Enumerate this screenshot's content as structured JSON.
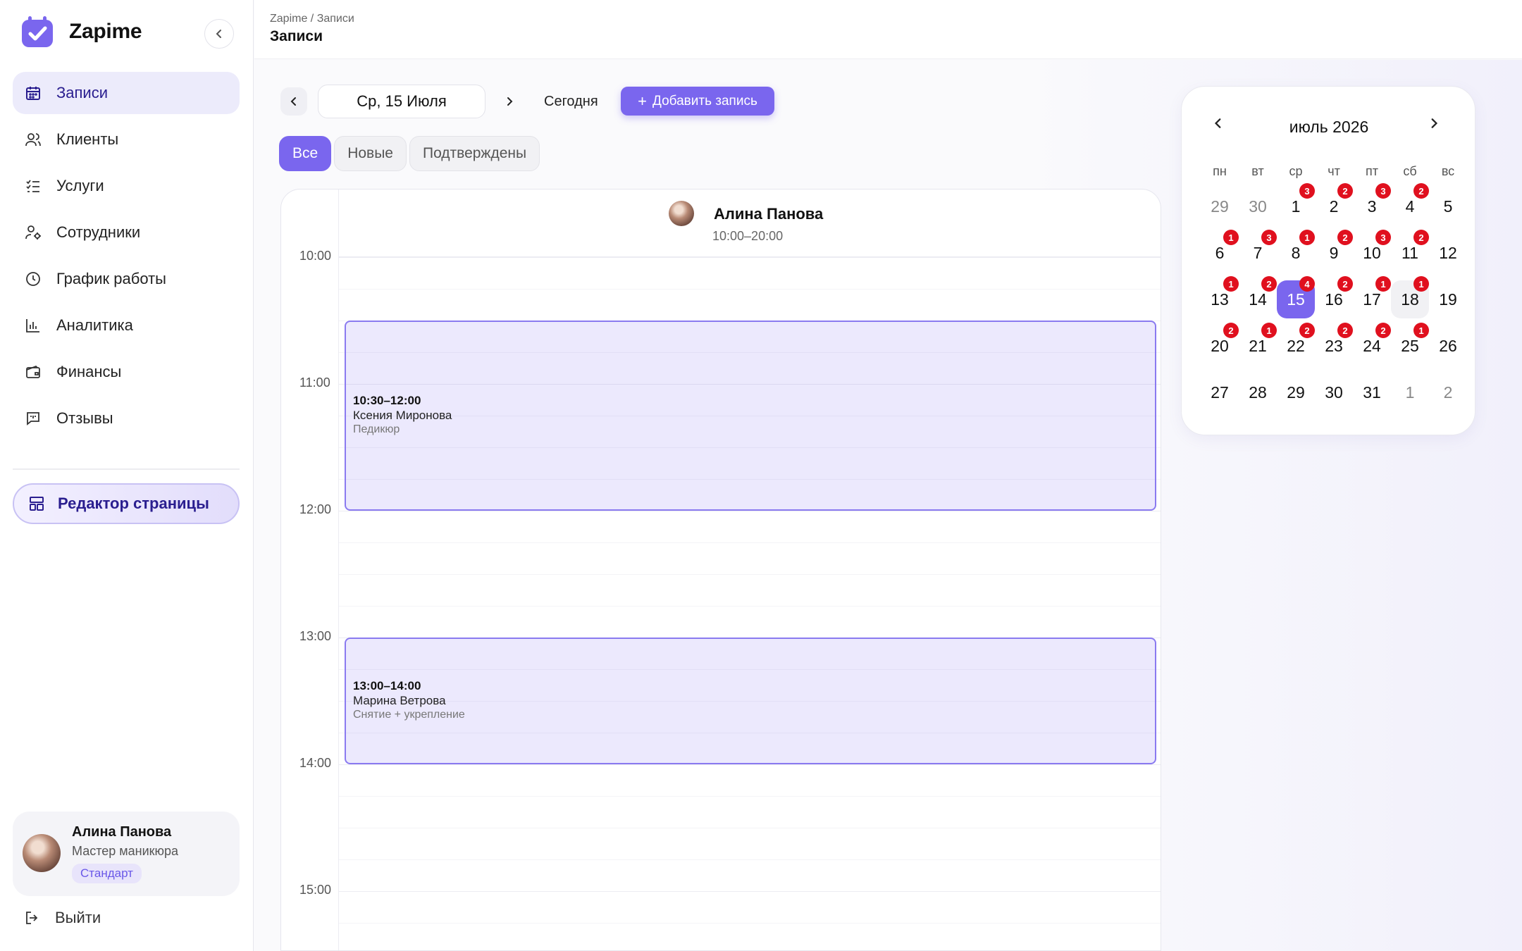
{
  "app": {
    "name": "Zapime",
    "accent": "#7a66ee",
    "badge_color": "#e0101e"
  },
  "sidebar": {
    "items": [
      {
        "label": "Записи",
        "icon": "calendar-icon",
        "active": true
      },
      {
        "label": "Клиенты",
        "icon": "users-icon"
      },
      {
        "label": "Услуги",
        "icon": "checklist-icon"
      },
      {
        "label": "Сотрудники",
        "icon": "staff-icon"
      },
      {
        "label": "График работы",
        "icon": "clock-icon"
      },
      {
        "label": "Аналитика",
        "icon": "bar-chart-icon"
      },
      {
        "label": "Финансы",
        "icon": "wallet-icon"
      },
      {
        "label": "Отзывы",
        "icon": "message-icon"
      }
    ],
    "editor_label": "Редактор страницы",
    "profile": {
      "name": "Алина Панова",
      "role": "Мастер маникюра",
      "plan": "Стандарт"
    },
    "logout_label": "Выйти"
  },
  "header": {
    "breadcrumb": "Zapime / Записи",
    "title": "Записи"
  },
  "toolbar": {
    "date": "Ср, 15 Июля",
    "today_label": "Сегодня",
    "add_label": "Добавить запись"
  },
  "filters": [
    {
      "label": "Все",
      "active": true
    },
    {
      "label": "Новые"
    },
    {
      "label": "Подтверждены"
    }
  ],
  "schedule": {
    "employee": {
      "name": "Алина Панова",
      "hours": "10:00–20:00"
    },
    "time_labels": [
      "10:00",
      "11:00",
      "12:00",
      "13:00",
      "14:00",
      "15:00"
    ],
    "appointments": [
      {
        "time": "10:30–12:00",
        "client": "Ксения Миронова",
        "service": "Педикюр"
      },
      {
        "time": "13:00–14:00",
        "client": "Марина Ветрова",
        "service": "Снятие + укрепление"
      }
    ]
  },
  "mini_calendar": {
    "title": "июль 2026",
    "weekdays": [
      "пн",
      "вт",
      "ср",
      "чт",
      "пт",
      "сб",
      "вс"
    ],
    "days": [
      {
        "d": "29",
        "out": true
      },
      {
        "d": "30",
        "out": true
      },
      {
        "d": "1",
        "b": "3"
      },
      {
        "d": "2",
        "b": "2"
      },
      {
        "d": "3",
        "b": "3"
      },
      {
        "d": "4",
        "b": "2"
      },
      {
        "d": "5"
      },
      {
        "d": "6",
        "b": "1"
      },
      {
        "d": "7",
        "b": "3"
      },
      {
        "d": "8",
        "b": "1"
      },
      {
        "d": "9",
        "b": "2"
      },
      {
        "d": "10",
        "b": "3"
      },
      {
        "d": "11",
        "b": "2"
      },
      {
        "d": "12"
      },
      {
        "d": "13",
        "b": "1"
      },
      {
        "d": "14",
        "b": "2"
      },
      {
        "d": "15",
        "b": "4",
        "sel": true
      },
      {
        "d": "16",
        "b": "2"
      },
      {
        "d": "17",
        "b": "1"
      },
      {
        "d": "18",
        "b": "1",
        "hov": true
      },
      {
        "d": "19"
      },
      {
        "d": "20",
        "b": "2"
      },
      {
        "d": "21",
        "b": "1"
      },
      {
        "d": "22",
        "b": "2"
      },
      {
        "d": "23",
        "b": "2"
      },
      {
        "d": "24",
        "b": "2"
      },
      {
        "d": "25",
        "b": "1"
      },
      {
        "d": "26"
      },
      {
        "d": "27"
      },
      {
        "d": "28"
      },
      {
        "d": "29"
      },
      {
        "d": "30"
      },
      {
        "d": "31"
      },
      {
        "d": "1",
        "out": true
      },
      {
        "d": "2",
        "out": true
      }
    ]
  }
}
